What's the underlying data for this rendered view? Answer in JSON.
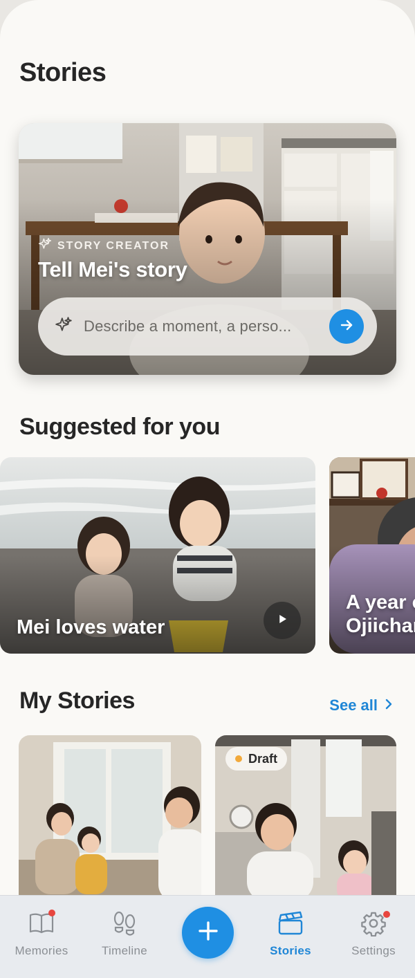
{
  "header": {
    "title": "Stories"
  },
  "hero": {
    "eyebrow": "STORY CREATOR",
    "title": "Tell Mei's story",
    "prompt_placeholder": "Describe a moment, a perso...",
    "sparkle_icon": "sparkle-icon",
    "send_icon": "arrow-right-icon"
  },
  "suggested": {
    "title": "Suggested for you",
    "cards": [
      {
        "title": "Mei loves water",
        "has_play": true,
        "play_icon": "play-icon"
      },
      {
        "title_line1": "A year o",
        "title_line2": "Ojiichan"
      }
    ]
  },
  "my_stories": {
    "title": "My Stories",
    "see_all": "See all",
    "cards": [
      {
        "badge": ""
      },
      {
        "badge": "Draft"
      }
    ]
  },
  "tabbar": {
    "tabs": [
      {
        "label": "Memories",
        "icon": "book-icon",
        "has_notification": true
      },
      {
        "label": "Timeline",
        "icon": "footprints-icon",
        "has_notification": false
      },
      {
        "label": "",
        "icon": "plus-icon"
      },
      {
        "label": "Stories",
        "icon": "clapperboard-icon",
        "active": true
      },
      {
        "label": "Settings",
        "icon": "gear-icon",
        "has_notification": true
      }
    ]
  },
  "colors": {
    "accent": "#1f8fe3",
    "background": "#faf9f6",
    "notification": "#e8463f",
    "draft": "#f2a93b"
  }
}
